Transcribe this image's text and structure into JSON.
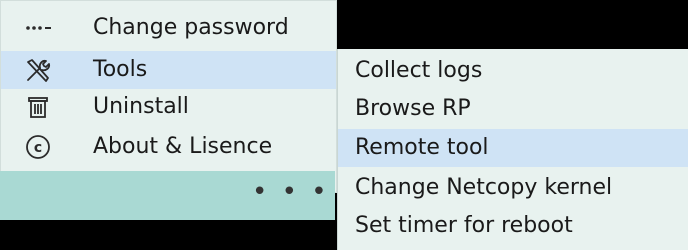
{
  "menu": {
    "items": [
      {
        "label": "Change password",
        "icon": "password-dots-icon"
      },
      {
        "label": "Tools",
        "icon": "tools-icon"
      },
      {
        "label": "Uninstall",
        "icon": "trash-icon"
      },
      {
        "label": "About & Lisence",
        "icon": "copyright-icon"
      }
    ],
    "more_label": "• • •"
  },
  "submenu": {
    "items": [
      {
        "label": "Collect logs"
      },
      {
        "label": "Browse RP"
      },
      {
        "label": "Remote tool"
      },
      {
        "label": "Change Netcopy kernel"
      },
      {
        "label": "Set timer for reboot"
      }
    ]
  },
  "colors": {
    "menu_bg": "#e8f2ef",
    "highlight": "#cfe3f5",
    "more_bar": "#a9d9d3",
    "outer": "#000000"
  }
}
